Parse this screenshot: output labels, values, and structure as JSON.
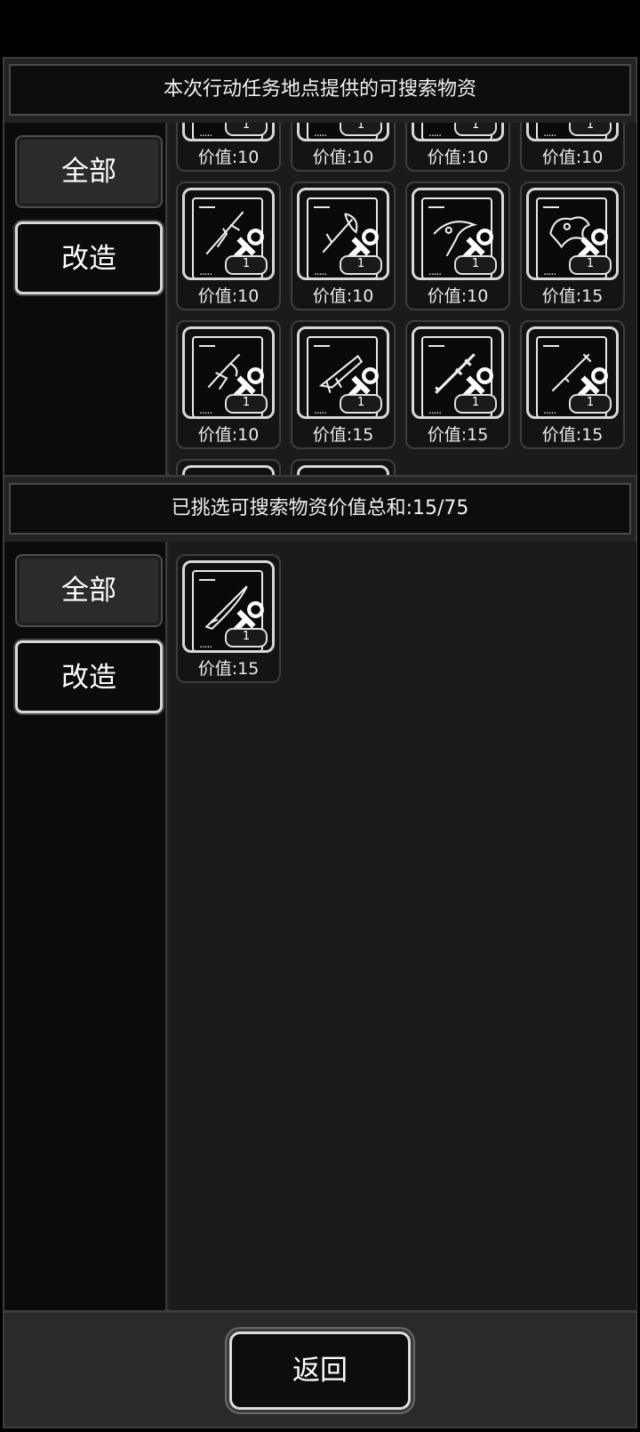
{
  "top_panel": {
    "title": "本次行动任务地点提供的可搜索物资",
    "tabs": [
      {
        "label": "全部",
        "active": true
      },
      {
        "label": "改造",
        "active": false
      }
    ],
    "items": [
      {
        "value_label": "价值:10",
        "qty": "1",
        "icon": "blueprint-partial-icon"
      },
      {
        "value_label": "价值:10",
        "qty": "1",
        "icon": "blueprint-partial-icon"
      },
      {
        "value_label": "价值:10",
        "qty": "1",
        "icon": "blueprint-partial-icon"
      },
      {
        "value_label": "价值:10",
        "qty": "1",
        "icon": "blueprint-partial-icon"
      },
      {
        "value_label": "价值:10",
        "qty": "1",
        "icon": "blueprint-spear-icon"
      },
      {
        "value_label": "价值:10",
        "qty": "1",
        "icon": "blueprint-axe-icon"
      },
      {
        "value_label": "价值:10",
        "qty": "1",
        "icon": "blueprint-hook-icon"
      },
      {
        "value_label": "价值:15",
        "qty": "1",
        "icon": "blueprint-dragon-icon"
      },
      {
        "value_label": "价值:10",
        "qty": "1",
        "icon": "blueprint-claw-icon"
      },
      {
        "value_label": "价值:15",
        "qty": "1",
        "icon": "blueprint-gun-icon"
      },
      {
        "value_label": "价值:15",
        "qty": "1",
        "icon": "blueprint-staff-icon"
      },
      {
        "value_label": "价值:15",
        "qty": "1",
        "icon": "blueprint-rod-icon"
      }
    ]
  },
  "bottom_panel": {
    "title": "已挑选可搜索物资价值总和:15/75",
    "tabs": [
      {
        "label": "全部",
        "active": true
      },
      {
        "label": "改造",
        "active": false
      }
    ],
    "items": [
      {
        "value_label": "价值:15",
        "qty": "1",
        "icon": "blueprint-blade-icon"
      }
    ]
  },
  "footer": {
    "back_label": "返回"
  }
}
